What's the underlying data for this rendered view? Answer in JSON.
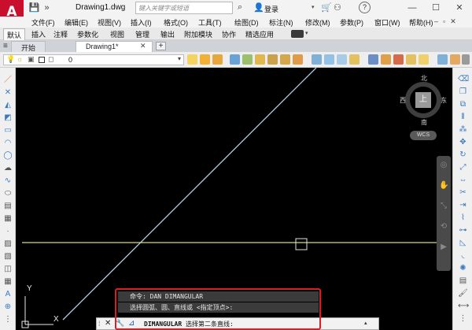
{
  "app": {
    "logo_letter": "A",
    "document_title": "Drawing1.dwg",
    "search_placeholder": "键入关键字或短语",
    "login_label": "登录"
  },
  "menubar": {
    "items": [
      "文件(F)",
      "编辑(E)",
      "视图(V)",
      "插入(I)",
      "格式(O)",
      "工具(T)",
      "绘图(D)",
      "标注(N)",
      "修改(M)",
      "参数(P)",
      "窗口(W)",
      "帮助(H)"
    ]
  },
  "ribbon": {
    "tabs": [
      "默认",
      "插入",
      "注释",
      "参数化",
      "视图",
      "管理",
      "输出",
      "附加模块",
      "协作",
      "精选应用"
    ],
    "active_tab": "默认"
  },
  "file_tabs": {
    "start_label": "开始",
    "drawing_label": "Drawing1*"
  },
  "toolbar": {
    "current_layer": "0"
  },
  "viewcube": {
    "north": "北",
    "south": "南",
    "west": "西",
    "east": "东",
    "top_face": "上",
    "wcs_label": "WCS"
  },
  "ucs": {
    "x_label": "X",
    "y_label": "Y"
  },
  "command": {
    "history": [
      "命令: DAN DIMANGULAR",
      "选择圆弧、圆、直线或 <指定顶点>:"
    ],
    "current_command": "DIMANGULAR",
    "current_prompt": " 选择第二条直线:"
  },
  "colors": {
    "canvas_bg": "#000000",
    "diagonal_line": "#a9cde0",
    "horizontal_line": "#d6d88a",
    "highlight_border": "#e01b24",
    "logo_red": "#c8102e"
  }
}
